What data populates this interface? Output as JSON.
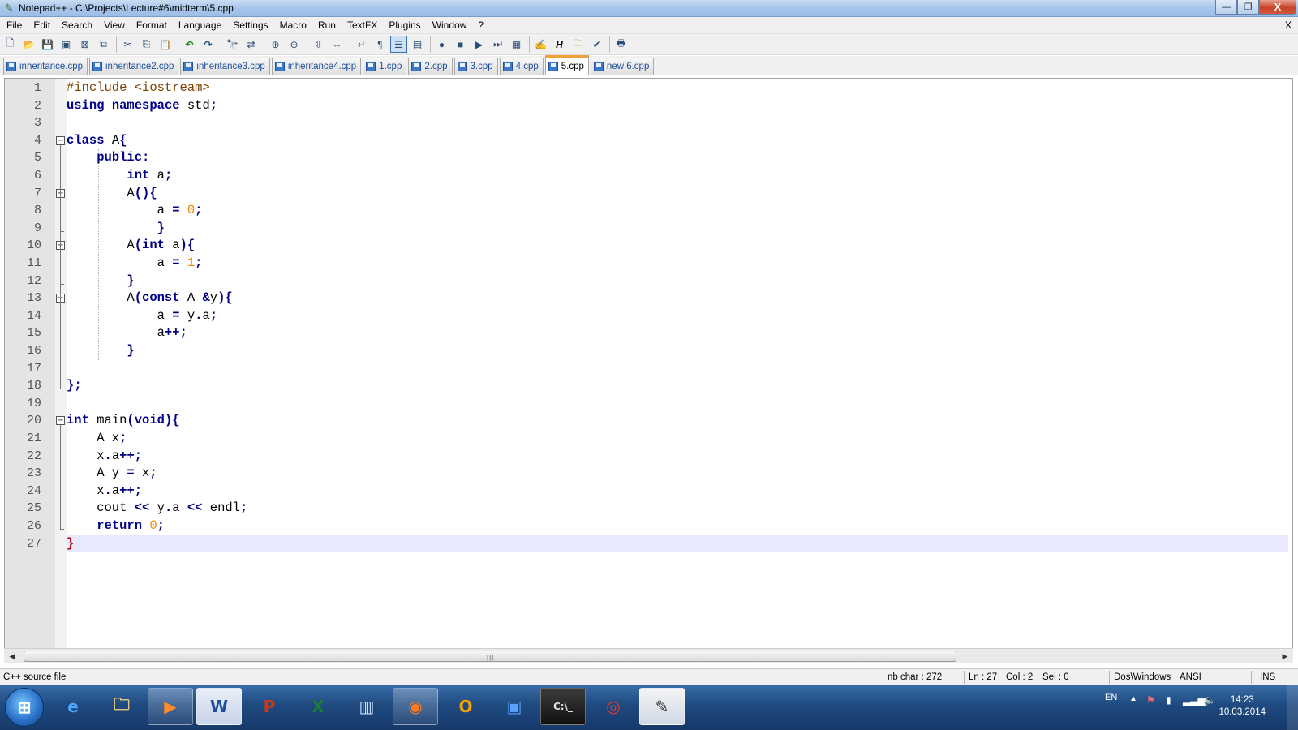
{
  "window": {
    "title": "Notepad++ - C:\\Projects\\Lecture#6\\midterm\\5.cpp",
    "minimize": "—",
    "restore": "❐",
    "close": "X"
  },
  "menu": [
    "File",
    "Edit",
    "Search",
    "View",
    "Format",
    "Language",
    "Settings",
    "Macro",
    "Run",
    "TextFX",
    "Plugins",
    "Window",
    "?"
  ],
  "menu_close": "X",
  "toolbar_icons": [
    "new-file-icon",
    "open-file-icon",
    "save-icon",
    "save-all-icon",
    "close-icon",
    "close-all-icon",
    "print-icon",
    "cut-icon",
    "copy-icon",
    "paste-icon",
    "undo-icon",
    "redo-icon",
    "find-icon",
    "replace-icon",
    "zoom-in-icon",
    "zoom-out-icon",
    "sync-vertical-icon",
    "sync-horizontal-icon",
    "word-wrap-icon",
    "show-all-chars-icon",
    "indent-guide-icon",
    "user-lang-icon",
    "record-macro-icon",
    "stop-record-icon",
    "play-macro-icon",
    "run-macro-multiple-icon",
    "save-macro-icon",
    "pdf-icon",
    "html-icon",
    "folder-icon",
    "spellcheck-icon",
    "print-now-icon"
  ],
  "tabs": [
    {
      "label": "inheritance.cpp",
      "active": false
    },
    {
      "label": "inheritance2.cpp",
      "active": false
    },
    {
      "label": "inheritance3.cpp",
      "active": false
    },
    {
      "label": "inheritance4.cpp",
      "active": false
    },
    {
      "label": "1.cpp",
      "active": false
    },
    {
      "label": "2.cpp",
      "active": false
    },
    {
      "label": "3.cpp",
      "active": false
    },
    {
      "label": "4.cpp",
      "active": false
    },
    {
      "label": "5.cpp",
      "active": true
    },
    {
      "label": "new 6.cpp",
      "active": false
    }
  ],
  "code_lines": [
    "#include <iostream>",
    "using namespace std;",
    "",
    "class A{",
    "    public:",
    "        int a;",
    "        A(){",
    "            a = 0;",
    "            }",
    "        A(int a){",
    "            a = 1;",
    "        }",
    "        A(const A &y){",
    "            a = y.a;",
    "            a++;",
    "        }",
    "",
    "};",
    "",
    "int main(void){",
    "    A x;",
    "    x.a++;",
    "    A y = x;",
    "    x.a++;",
    "    cout << y.a << endl;",
    "    return 0;",
    "}"
  ],
  "current_line": 27,
  "status": {
    "file_type": "C++ source file",
    "nb_char": "nb char : 272",
    "ln": "Ln : 27",
    "col": "Col : 2",
    "sel": "Sel : 0",
    "eol": "Dos\\Windows",
    "encoding": "ANSI",
    "mode": "INS"
  },
  "taskbar": {
    "language": "EN",
    "time": "14:23",
    "date": "10.03.2014"
  }
}
